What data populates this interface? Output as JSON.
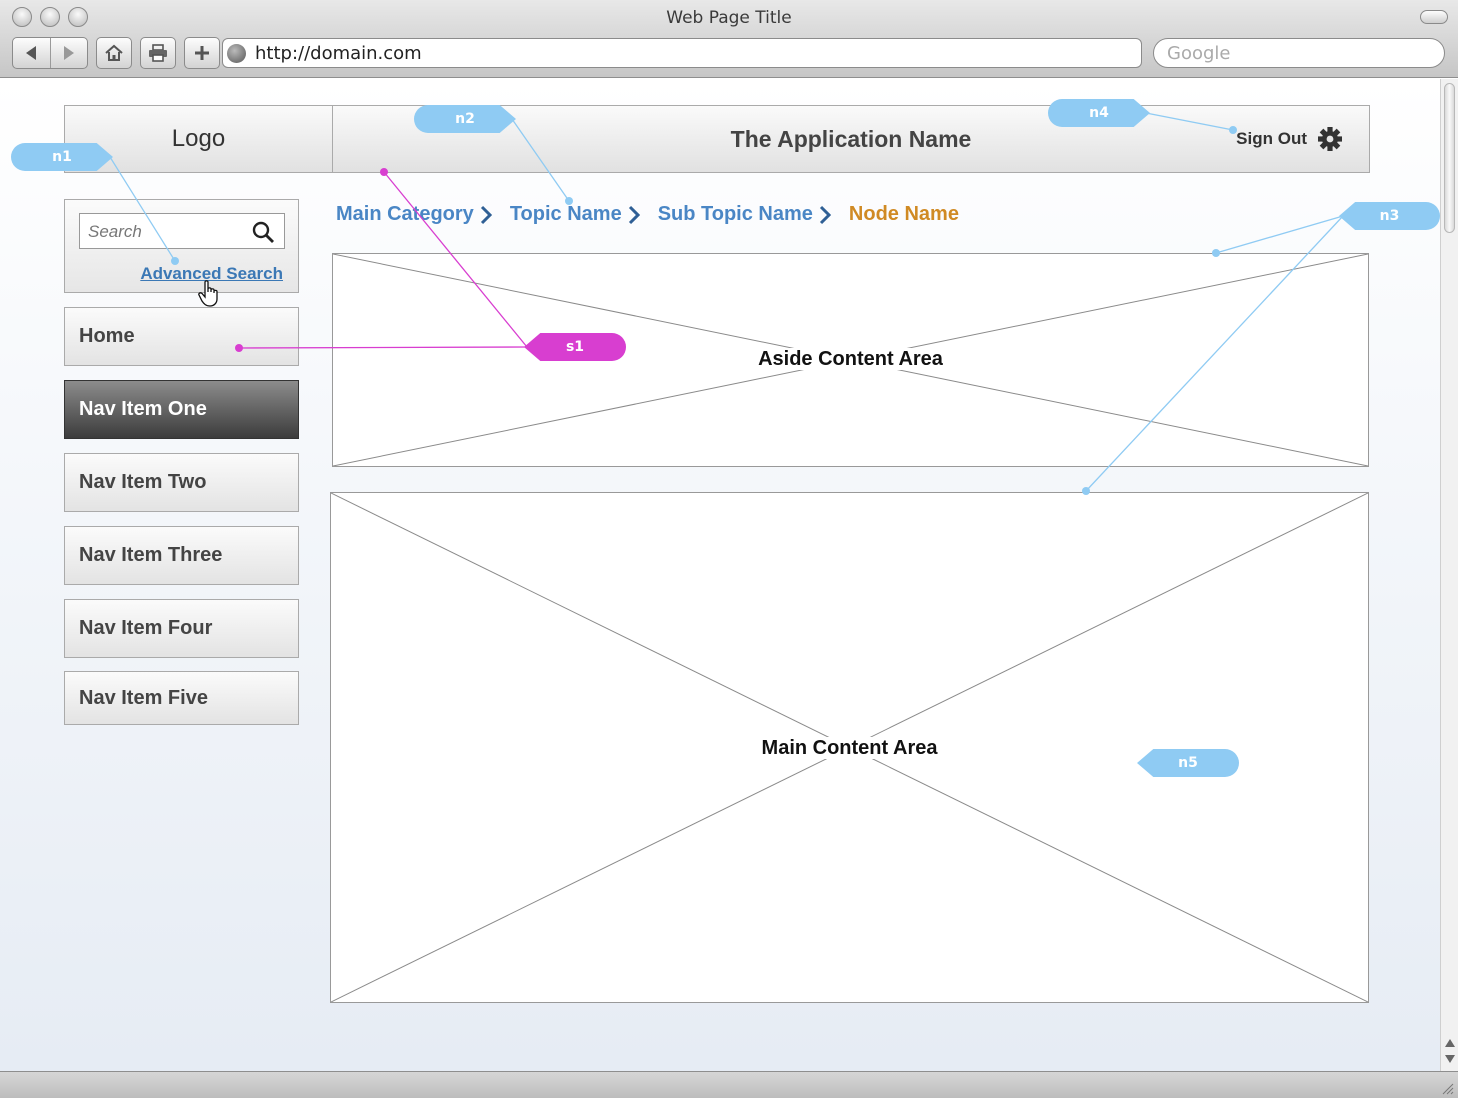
{
  "window": {
    "title": "Web Page Title"
  },
  "browser": {
    "url": "http://domain.com",
    "search_placeholder": "Google"
  },
  "header": {
    "logo": "Logo",
    "app_name": "The Application Name",
    "sign_out": "Sign Out"
  },
  "sidebar": {
    "search_placeholder": "Search",
    "advanced_search": "Advanced Search",
    "nav": [
      {
        "label": "Home",
        "active": false
      },
      {
        "label": "Nav Item One",
        "active": true
      },
      {
        "label": "Nav Item Two",
        "active": false
      },
      {
        "label": "Nav Item Three",
        "active": false
      },
      {
        "label": "Nav Item Four",
        "active": false
      },
      {
        "label": "Nav Item Five",
        "active": false
      }
    ]
  },
  "breadcrumb": [
    "Main Category",
    "Topic Name",
    "Sub Topic Name",
    "Node Name"
  ],
  "content": {
    "aside_label": "Aside Content Area",
    "main_label": "Main Content Area"
  },
  "annotations": {
    "n1": "n1",
    "n2": "n2",
    "n3": "n3",
    "n4": "n4",
    "n5": "n5",
    "s1": "s1",
    "note_color": "#8fcbf3",
    "screen_color": "#d83ed0"
  },
  "colors": {
    "link": "#4a86c5",
    "current_crumb": "#d08a24",
    "active_nav": "#3c3c3c"
  }
}
